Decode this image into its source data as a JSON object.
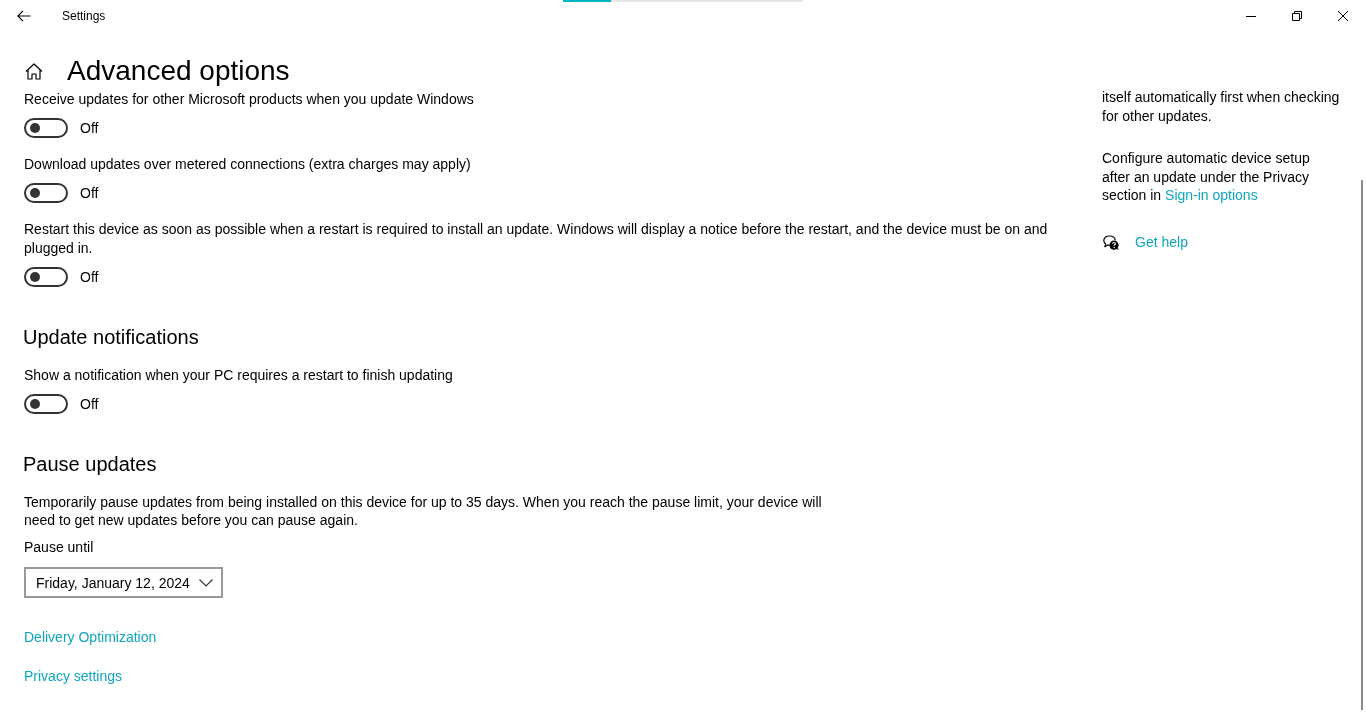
{
  "window": {
    "title": "Settings",
    "progress": {
      "level": 0.2
    }
  },
  "page": {
    "title": "Advanced options"
  },
  "settings": [
    {
      "kind": "toggle",
      "label": "Receive updates for other Microsoft products when you update Windows",
      "on": false,
      "state": "Off"
    },
    {
      "kind": "toggle",
      "label": "Download updates over metered connections (extra charges may apply)",
      "on": false,
      "state": "Off"
    },
    {
      "kind": "toggle",
      "label": "Restart this device as soon as possible when a restart is required to install an update. Windows will display a notice before the restart, and the device must be on and plugged in.",
      "on": false,
      "state": "Off"
    },
    {
      "kind": "heading",
      "text": "Update notifications"
    },
    {
      "kind": "toggle",
      "label": "Show a notification when your PC requires a restart to finish updating",
      "on": false,
      "state": "Off"
    },
    {
      "kind": "heading",
      "text": "Pause updates"
    },
    {
      "kind": "paragraph",
      "text": "Temporarily pause updates from being installed on this device for up to 35 days. When you reach the pause limit, your device will need to get new updates before you can pause again."
    },
    {
      "kind": "dropdown",
      "label": "Pause until",
      "value": "Friday, January 12, 2024"
    },
    {
      "kind": "link",
      "text": "Delivery Optimization"
    },
    {
      "kind": "link",
      "text": "Privacy settings"
    }
  ],
  "sidebar": {
    "paragraphs": [
      {
        "text": "itself automatically first when checking for other updates."
      },
      {
        "text": "Configure automatic device setup after an update under the Privacy section in",
        "link": "Sign-in options"
      }
    ],
    "help": {
      "label": "Get help"
    }
  }
}
